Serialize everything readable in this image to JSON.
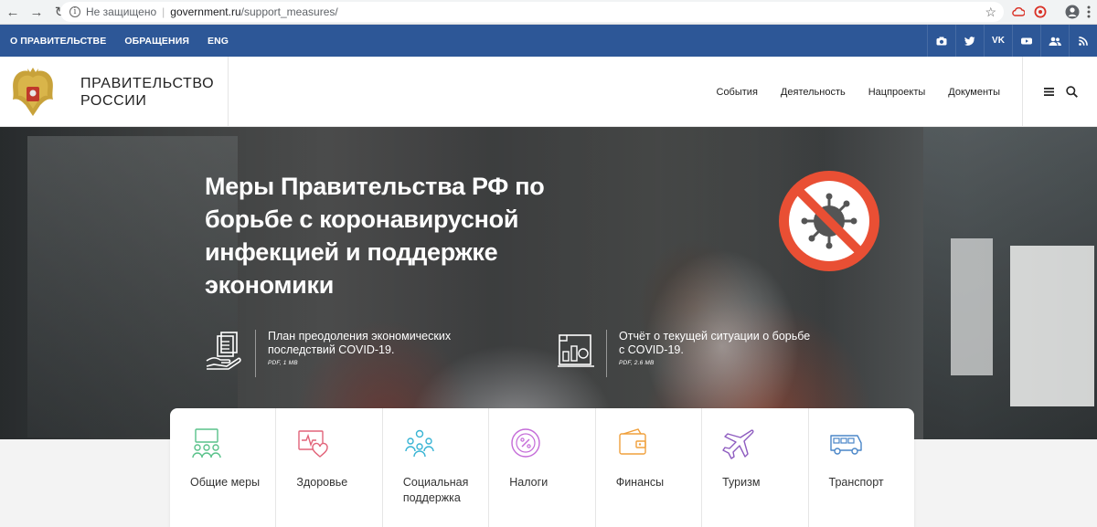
{
  "browser": {
    "security_label": "Не защищено",
    "url_host": "government.ru",
    "url_path": "/support_measures/"
  },
  "topbar": {
    "links": [
      "О ПРАВИТЕЛЬСТВЕ",
      "ОБРАЩЕНИЯ",
      "ENG"
    ],
    "social_icons": [
      "camera-icon",
      "twitter-icon",
      "vk-icon",
      "youtube-icon",
      "users-icon",
      "rss-icon"
    ]
  },
  "header": {
    "title_line1": "ПРАВИТЕЛЬСТВО",
    "title_line2": "РОССИИ",
    "nav": [
      "События",
      "Деятельность",
      "Нацпроекты",
      "Документы"
    ]
  },
  "hero": {
    "title": "Меры Правительства РФ по борьбе с коронавирусной инфекцией и поддержке экономики",
    "docs": [
      {
        "title": "План преодоления экономических последствий COVID-19.",
        "size": "PDF, 1 MB"
      },
      {
        "title": "Отчёт о текущей ситуации о борьбе с COVID-19.",
        "size": "PDF, 2.6 MB"
      }
    ]
  },
  "categories": [
    {
      "label": "Общие меры",
      "icon": "general-measures-icon",
      "color": "#59c28a"
    },
    {
      "label": "Здоровье",
      "icon": "health-icon",
      "color": "#e2647a"
    },
    {
      "label": "Социальная поддержка",
      "icon": "social-support-icon",
      "color": "#38b4d4"
    },
    {
      "label": "Налоги",
      "icon": "taxes-icon",
      "color": "#c46bd8"
    },
    {
      "label": "Финансы",
      "icon": "finance-icon",
      "color": "#f0a03c"
    },
    {
      "label": "Туризм",
      "icon": "tourism-icon",
      "color": "#8e5cc0"
    },
    {
      "label": "Транспорт",
      "icon": "transport-icon",
      "color": "#4a86c8"
    }
  ],
  "colors": {
    "topbar": "#2d5797",
    "no_virus": "#e94f34"
  }
}
